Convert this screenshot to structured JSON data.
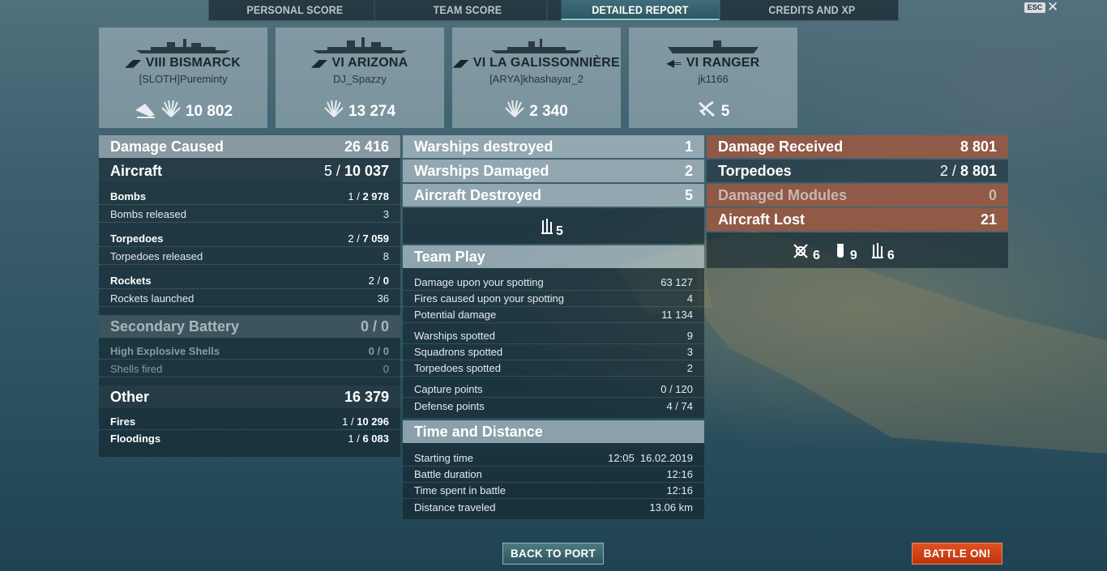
{
  "tabs": {
    "personal": "PERSONAL SCORE",
    "team": "TEAM SCORE",
    "detailed": "DETAILED REPORT",
    "credits": "CREDITS AND XP"
  },
  "window": {
    "esc_label": "ESC",
    "close_label": "✕"
  },
  "ships": [
    {
      "name": "VIII BISMARCK",
      "player": "[SLOTH]Pureminty",
      "value": "10 802",
      "icon": "battleship-icon",
      "stat_icons": [
        "sunk-ship-icon",
        "damage-burst-icon"
      ]
    },
    {
      "name": "VI ARIZONA",
      "player": "DJ_Spazzy",
      "value": "13 274",
      "icon": "battleship-icon",
      "stat_icons": [
        "damage-burst-icon"
      ]
    },
    {
      "name": "VI LA GALISSONNIÈRE",
      "player": "[ARYA]khashayar_2",
      "value": "2 340",
      "icon": "cruiser-icon",
      "stat_icons": [
        "damage-burst-icon"
      ]
    },
    {
      "name": "VI RANGER",
      "player": "jk1166",
      "value": "5",
      "icon": "carrier-icon",
      "stat_icons": [
        "plane-shot-icon"
      ]
    }
  ],
  "damage_caused": {
    "title": "Damage Caused",
    "total": "26 416",
    "aircraft": {
      "label": "Aircraft",
      "count": "5 /",
      "value": "10 037"
    },
    "bombs": {
      "label": "Bombs",
      "count": "1 /",
      "value": "2 978"
    },
    "bombs_released": {
      "label": "Bombs released",
      "value": "3"
    },
    "torpedoes": {
      "label": "Torpedoes",
      "count": "2 /",
      "value": "7 059"
    },
    "torpedoes_released": {
      "label": "Torpedoes released",
      "value": "8"
    },
    "rockets": {
      "label": "Rockets",
      "count": "2 /",
      "value": "0"
    },
    "rockets_launched": {
      "label": "Rockets launched",
      "value": "36"
    },
    "secondary": {
      "label": "Secondary Battery",
      "value": "0 / 0"
    },
    "he_shells": {
      "label": "High Explosive Shells",
      "value": "0 / 0"
    },
    "shells_fired": {
      "label": "Shells fired",
      "value": "0"
    },
    "other": {
      "label": "Other",
      "value": "16 379"
    },
    "fires": {
      "label": "Fires",
      "count": "1 /",
      "value": "10 296"
    },
    "floodings": {
      "label": "Floodings",
      "count": "1 /",
      "value": "6 083"
    }
  },
  "middle": {
    "warships_destroyed": {
      "label": "Warships destroyed",
      "value": "1"
    },
    "warships_damaged": {
      "label": "Warships Damaged",
      "value": "2"
    },
    "aircraft_destroyed": {
      "label": "Aircraft Destroyed",
      "value": "5"
    },
    "aircraft_icon_count": "5",
    "team_play": {
      "title": "Team Play",
      "rows": [
        {
          "label": "Damage upon your spotting",
          "value": "63 127"
        },
        {
          "label": "Fires caused upon your spotting",
          "value": "4"
        },
        {
          "label": "Potential damage",
          "value": "11 134"
        },
        {
          "label": "Warships spotted",
          "value": "9"
        },
        {
          "label": "Squadrons spotted",
          "value": "3"
        },
        {
          "label": "Torpedoes spotted",
          "value": "2"
        },
        {
          "label": "Capture points",
          "value": "0 / 120"
        },
        {
          "label": "Defense points",
          "value": "4 / 74"
        }
      ]
    },
    "time_distance": {
      "title": "Time and Distance",
      "rows": [
        {
          "label": "Starting time",
          "value": "12:05  16.02.2019"
        },
        {
          "label": "Battle duration",
          "value": "12:16"
        },
        {
          "label": "Time spent in battle",
          "value": "12:16"
        },
        {
          "label": "Distance traveled",
          "value": "13.06 km"
        }
      ]
    }
  },
  "damage_received": {
    "title": "Damage Received",
    "total": "8 801",
    "torpedoes": {
      "label": "Torpedoes",
      "count": "2 /",
      "value": "8 801"
    },
    "modules": {
      "label": "Damaged Modules",
      "value": "0"
    },
    "aircraft_lost": {
      "label": "Aircraft Lost",
      "value": "21"
    },
    "lost_icons": [
      {
        "icon": "fighter-icon",
        "value": "6"
      },
      {
        "icon": "bomber-icon",
        "value": "9"
      },
      {
        "icon": "torpedo-bomber-icon",
        "value": "6"
      }
    ]
  },
  "buttons": {
    "back": "BACK TO PORT",
    "battle": "BATTLE ON!"
  }
}
